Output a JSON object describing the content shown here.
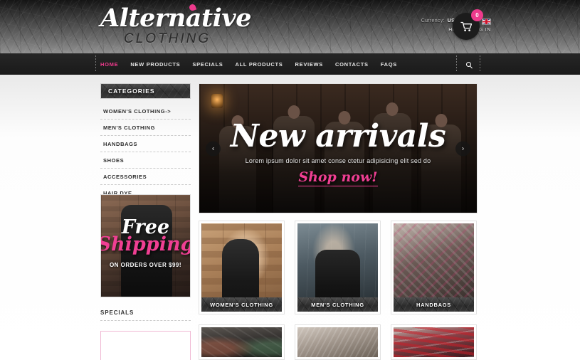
{
  "header": {
    "logo_main": "Alternative",
    "logo_sub": "CLOTHING",
    "currency_label": "Currency:",
    "currency_value": "US Dollar",
    "flag_icon": "uk-flag-icon",
    "links": [
      "HOME",
      "LOG IN"
    ],
    "cart_icon": "shopping-cart-icon",
    "cart_count": "0"
  },
  "nav": {
    "items": [
      {
        "label": "HOME",
        "active": true
      },
      {
        "label": "NEW PRODUCTS",
        "active": false
      },
      {
        "label": "SPECIALS",
        "active": false
      },
      {
        "label": "ALL PRODUCTS",
        "active": false
      },
      {
        "label": "REVIEWS",
        "active": false
      },
      {
        "label": "CONTACTS",
        "active": false
      },
      {
        "label": "FAQS",
        "active": false
      }
    ],
    "search_icon": "search-icon"
  },
  "sidebar": {
    "categories_title": "CATEGORIES",
    "categories": [
      "WOMEN'S CLOTHING->",
      "MEN'S CLOTHING",
      "HANDBAGS",
      "SHOES",
      "ACCESSORIES",
      "HAIR DYE"
    ],
    "promo": {
      "line1": "Free",
      "line2": "Shipping",
      "line3": "ON ORDERS OVER $99!"
    },
    "specials_title": "SPECIALS"
  },
  "slider": {
    "title": "New arrivals",
    "description": "Lorem ipsum dolor sit amet conse ctetur adipisicing elit sed do",
    "cta": "Shop now!",
    "prev_icon": "chevron-left-icon",
    "next_icon": "chevron-right-icon",
    "prev_glyph": "‹",
    "next_glyph": "›"
  },
  "tiles": [
    {
      "caption": "WOMEN'S CLOTHING",
      "image": "women-clothing-photo"
    },
    {
      "caption": "MEN'S CLOTHING",
      "image": "men-clothing-photo"
    },
    {
      "caption": "HANDBAGS",
      "image": "handbags-photo"
    }
  ],
  "tiles_bottom": [
    {
      "image": "shoes-photo"
    },
    {
      "image": "accessories-photo"
    },
    {
      "image": "hair-dye-photo"
    }
  ],
  "colors": {
    "accent_pink": "#ee3a8c",
    "nav_bg": "#1a1a1a",
    "page_bg": "#ffffff"
  }
}
